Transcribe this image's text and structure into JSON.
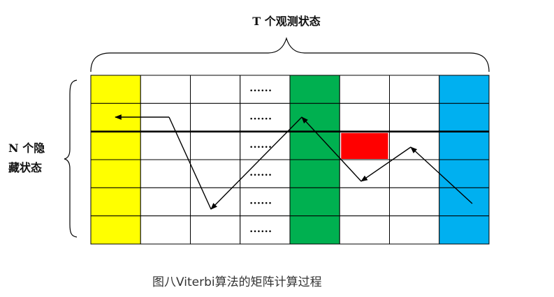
{
  "top_label": "T 个观测状态",
  "left_label": {
    "line1": "N 个隐",
    "line2": "藏状态"
  },
  "caption": "图八Viterbi算法的矩阵计算过程",
  "grid": {
    "columns": [
      {
        "fill": "#FFFF00"
      },
      {
        "fill": "#FFFFFF"
      },
      {
        "fill": "#FFFFFF"
      },
      {
        "fill": "#FFFFFF",
        "cell_text": "......"
      },
      {
        "fill": "#00B050"
      },
      {
        "fill": "#FFFFFF"
      },
      {
        "fill": "#FFFFFF"
      },
      {
        "fill": "#00B0F0"
      }
    ],
    "highlight_color": "#FF0000",
    "line_color": "#000000"
  }
}
